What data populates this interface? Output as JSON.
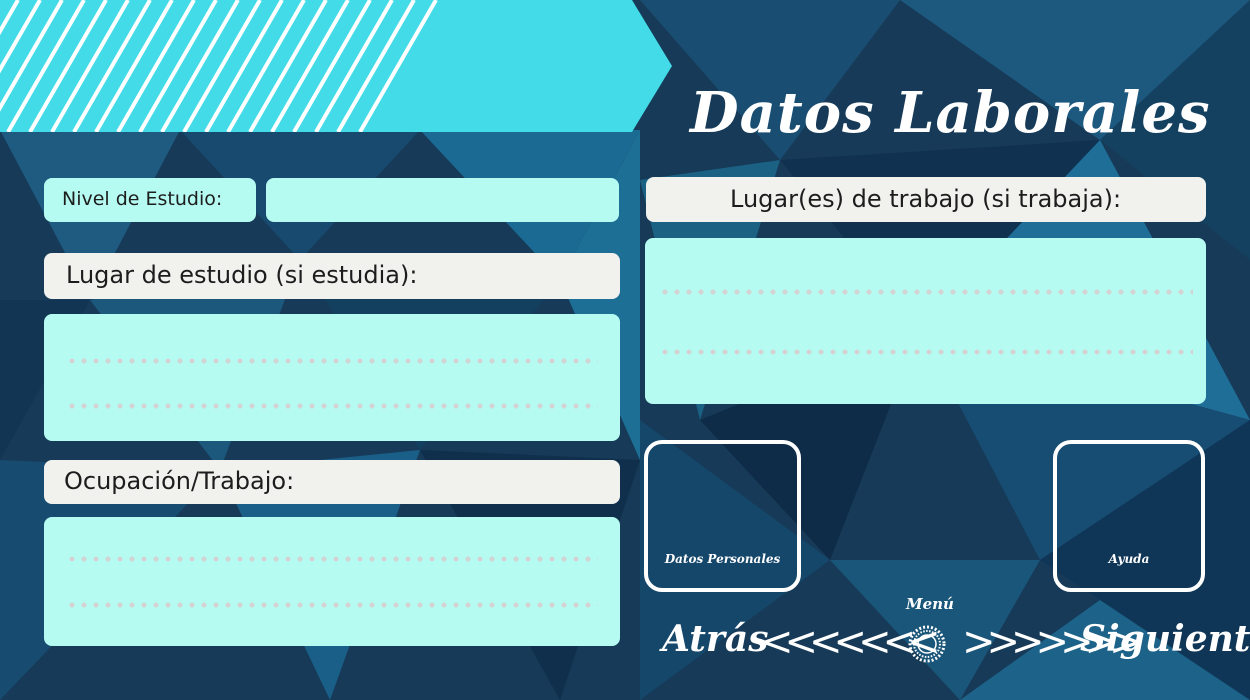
{
  "colors": {
    "background": "#163a57",
    "banner": "#44dbe8",
    "label_box": "#f1f1ee",
    "input_box": "#b6fbf2",
    "dotted_line": "#d3d3d3",
    "text_light": "#ffffff",
    "text_dark": "#1d1d1d"
  },
  "header": {
    "title": "Datos Laborales"
  },
  "form": {
    "nivel_estudio_label": "Nivel de Estudio:",
    "lugar_estudio_label": "Lugar de estudio (si estudia):",
    "ocupacion_label": "Ocupación/Trabajo:",
    "lugar_trabajo_label": "Lugar(es) de trabajo (si trabaja):"
  },
  "navigation": {
    "datos_personales_label": "Datos Personales",
    "ayuda_label": "Ayuda",
    "menu_label": "Menú",
    "atras_label": "Atrás",
    "siguiente_label": "Siguiente",
    "left_chevrons": "<<<<<<<",
    "right_chevrons": ">>>>>>>"
  },
  "icons": {
    "menu": "menu-ring-icon",
    "back": "chevrons-left-icon",
    "next": "chevrons-right-icon"
  }
}
